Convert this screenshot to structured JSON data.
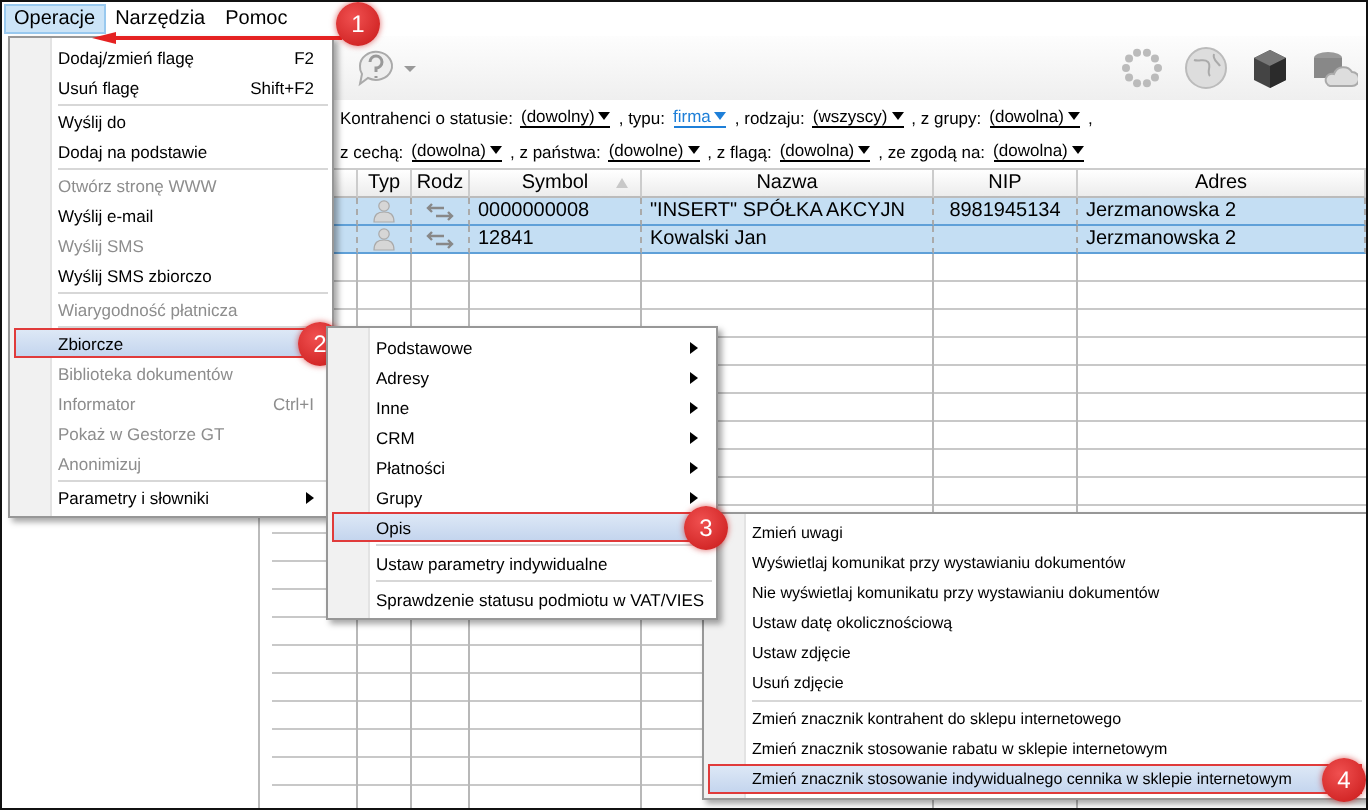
{
  "menubar": {
    "items": [
      {
        "label": "Operacje",
        "selected": true,
        "callout": "1"
      },
      {
        "label": "Narzędzia",
        "selected": false
      },
      {
        "label": "Pomoc",
        "selected": false
      }
    ]
  },
  "filters": {
    "lines": [
      {
        "parts": [
          {
            "kind": "label",
            "text": "Kontrahenci o statusie:"
          },
          {
            "kind": "dropdown",
            "text": "(dowolny)",
            "active": false
          },
          {
            "kind": "label",
            "text": ", typu:"
          },
          {
            "kind": "dropdown",
            "text": "firma",
            "active": true
          },
          {
            "kind": "label",
            "text": ", rodzaju:"
          },
          {
            "kind": "dropdown",
            "text": "(wszyscy)",
            "active": false
          },
          {
            "kind": "label",
            "text": ", z grupy:"
          },
          {
            "kind": "dropdown",
            "text": "(dowolna)",
            "active": false
          },
          {
            "kind": "label",
            "text": ","
          }
        ]
      },
      {
        "parts": [
          {
            "kind": "label",
            "text": "z cechą:"
          },
          {
            "kind": "dropdown",
            "text": "(dowolna)",
            "active": false
          },
          {
            "kind": "label",
            "text": ", z państwa:"
          },
          {
            "kind": "dropdown",
            "text": "(dowolne)",
            "active": false
          },
          {
            "kind": "label",
            "text": ", z flagą:"
          },
          {
            "kind": "dropdown",
            "text": "(dowolna)",
            "active": false
          },
          {
            "kind": "label",
            "text": ", ze zgodą na:"
          },
          {
            "kind": "dropdown",
            "text": "(dowolna)",
            "active": false
          }
        ]
      }
    ]
  },
  "table": {
    "columns": [
      {
        "label": "Typ",
        "sorted": false
      },
      {
        "label": "Rodz",
        "sorted": false
      },
      {
        "label": "Symbol",
        "sorted": true
      },
      {
        "label": "Nazwa",
        "sorted": false
      },
      {
        "label": "NIP",
        "sorted": false
      },
      {
        "label": "Adres",
        "sorted": false
      }
    ],
    "rows": [
      {
        "selected": true,
        "symbol": "0000000008",
        "nazwa": "\"INSERT\" SPÓŁKA AKCYJN",
        "nip": "8981945134",
        "adres": "Jerzmanowska 2"
      },
      {
        "selected": true,
        "symbol": "12841",
        "nazwa": "Kowalski Jan",
        "adres": "Jerzmanowska 2"
      }
    ]
  },
  "menus": [
    {
      "items": [
        {
          "kind": "item",
          "label": "Dodaj/zmień flagę",
          "shortcut": "F2",
          "disabled": false,
          "selected": false,
          "submenu": false
        },
        {
          "kind": "item",
          "label": "Usuń flagę",
          "shortcut": "Shift+F2",
          "disabled": false,
          "selected": false,
          "submenu": false
        },
        {
          "kind": "separator"
        },
        {
          "kind": "item",
          "label": "Wyślij do",
          "disabled": false,
          "selected": false,
          "submenu": false
        },
        {
          "kind": "item",
          "label": "Dodaj na podstawie",
          "disabled": false,
          "selected": false,
          "submenu": false
        },
        {
          "kind": "separator"
        },
        {
          "kind": "item",
          "label": "Otwórz stronę WWW",
          "disabled": true,
          "selected": false,
          "submenu": false
        },
        {
          "kind": "item",
          "label": "Wyślij e-mail",
          "disabled": false,
          "selected": false,
          "submenu": false
        },
        {
          "kind": "item",
          "label": "Wyślij SMS",
          "disabled": true,
          "selected": false,
          "submenu": false
        },
        {
          "kind": "item",
          "label": "Wyślij SMS zbiorczo",
          "disabled": false,
          "selected": false,
          "submenu": false
        },
        {
          "kind": "separator"
        },
        {
          "kind": "item",
          "label": "Wiarygodność płatnicza",
          "disabled": true,
          "selected": false,
          "submenu": false
        },
        {
          "kind": "separator"
        },
        {
          "kind": "item",
          "label": "Zbiorcze",
          "disabled": false,
          "selected": true,
          "submenu": false,
          "callout": "2"
        },
        {
          "kind": "item",
          "label": "Biblioteka dokumentów",
          "disabled": true,
          "selected": false,
          "submenu": false
        },
        {
          "kind": "item",
          "label": "Informator",
          "shortcut": "Ctrl+I",
          "disabled": true,
          "selected": false,
          "submenu": false
        },
        {
          "kind": "item",
          "label": "Pokaż w Gestorze GT",
          "disabled": true,
          "selected": false,
          "submenu": false
        },
        {
          "kind": "item",
          "label": "Anonimizuj",
          "disabled": true,
          "selected": false,
          "submenu": false
        },
        {
          "kind": "separator"
        },
        {
          "kind": "item",
          "label": "Parametry i słowniki",
          "disabled": false,
          "selected": false,
          "submenu": true
        }
      ]
    },
    {
      "items": [
        {
          "kind": "item",
          "label": "Podstawowe",
          "disabled": false,
          "selected": false,
          "submenu": true
        },
        {
          "kind": "item",
          "label": "Adresy",
          "disabled": false,
          "selected": false,
          "submenu": true
        },
        {
          "kind": "item",
          "label": "Inne",
          "disabled": false,
          "selected": false,
          "submenu": true
        },
        {
          "kind": "item",
          "label": "CRM",
          "disabled": false,
          "selected": false,
          "submenu": true
        },
        {
          "kind": "item",
          "label": "Płatności",
          "disabled": false,
          "selected": false,
          "submenu": true
        },
        {
          "kind": "item",
          "label": "Grupy",
          "disabled": false,
          "selected": false,
          "submenu": true
        },
        {
          "kind": "item",
          "label": "Opis",
          "disabled": false,
          "selected": true,
          "submenu": false,
          "callout": "3"
        },
        {
          "kind": "separator"
        },
        {
          "kind": "item",
          "label": "Ustaw parametry indywidualne",
          "disabled": false,
          "selected": false,
          "submenu": false
        },
        {
          "kind": "separator"
        },
        {
          "kind": "item",
          "label": "Sprawdzenie statusu podmiotu w VAT/VIES",
          "disabled": false,
          "selected": false,
          "submenu": false
        }
      ]
    },
    {
      "items": [
        {
          "kind": "item",
          "label": "Zmień uwagi",
          "disabled": false,
          "selected": false,
          "submenu": false
        },
        {
          "kind": "item",
          "label": "Wyświetlaj komunikat przy wystawianiu dokumentów",
          "disabled": false,
          "selected": false,
          "submenu": false
        },
        {
          "kind": "item",
          "label": "Nie wyświetlaj komunikatu przy wystawianiu dokumentów",
          "disabled": false,
          "selected": false,
          "submenu": false
        },
        {
          "kind": "item",
          "label": "Ustaw datę okolicznościową",
          "disabled": false,
          "selected": false,
          "submenu": false
        },
        {
          "kind": "item",
          "label": "Ustaw zdjęcie",
          "disabled": false,
          "selected": false,
          "submenu": false
        },
        {
          "kind": "item",
          "label": "Usuń zdjęcie",
          "disabled": false,
          "selected": false,
          "submenu": false
        },
        {
          "kind": "separator"
        },
        {
          "kind": "item",
          "label": "Zmień znacznik kontrahent do sklepu internetowego",
          "disabled": false,
          "selected": false,
          "submenu": false
        },
        {
          "kind": "item",
          "label": "Zmień znacznik stosowanie rabatu w sklepie internetowym",
          "disabled": false,
          "selected": false,
          "submenu": false
        },
        {
          "kind": "item",
          "label": "Zmień znacznik stosowanie indywidualnego cennika w sklepie internetowym",
          "disabled": false,
          "selected": true,
          "submenu": false,
          "callout": "4"
        }
      ]
    }
  ]
}
